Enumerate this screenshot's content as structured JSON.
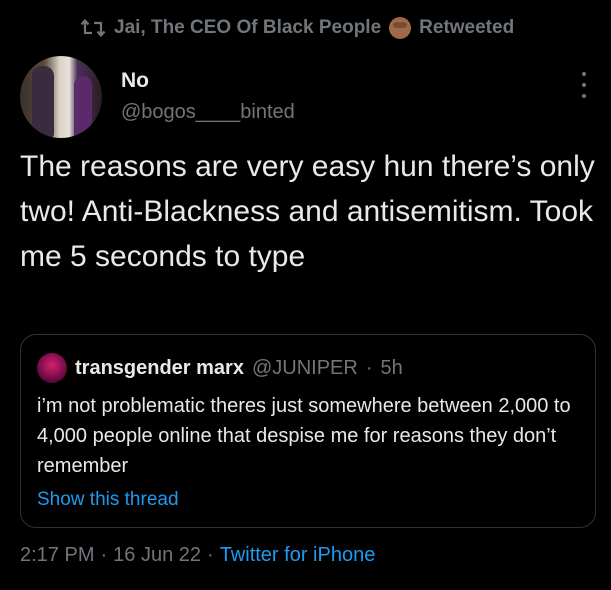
{
  "retweet_bar": {
    "icon": "retweet-icon",
    "user_name": "Jai, The CEO Of Black People",
    "emoji": "raised-fist-icon",
    "label": "Retweeted"
  },
  "tweet": {
    "display_name": "No",
    "handle": "@bogos____binted",
    "text": "The reasons are very easy hun there’s only two! Anti-Blackness and antisemitism. Took me 5 seconds to type",
    "more_icon": "more-options-icon"
  },
  "quote": {
    "display_name": "transgender marx",
    "handle": "@JUNIPER",
    "separator": "·",
    "time": "5h",
    "text": "i’m not problematic theres just somewhere between 2,000 to 4,000 people online that despise me for reasons they don’t remember",
    "show_thread": "Show this thread"
  },
  "meta": {
    "time": "2:17 PM",
    "dot1": "·",
    "date": "16 Jun 22",
    "dot2": "·",
    "source": "Twitter for iPhone"
  },
  "colors": {
    "background": "#000000",
    "text": "#e7e9ea",
    "muted": "#71767b",
    "link": "#1d9bf0",
    "border": "#2f3336"
  }
}
